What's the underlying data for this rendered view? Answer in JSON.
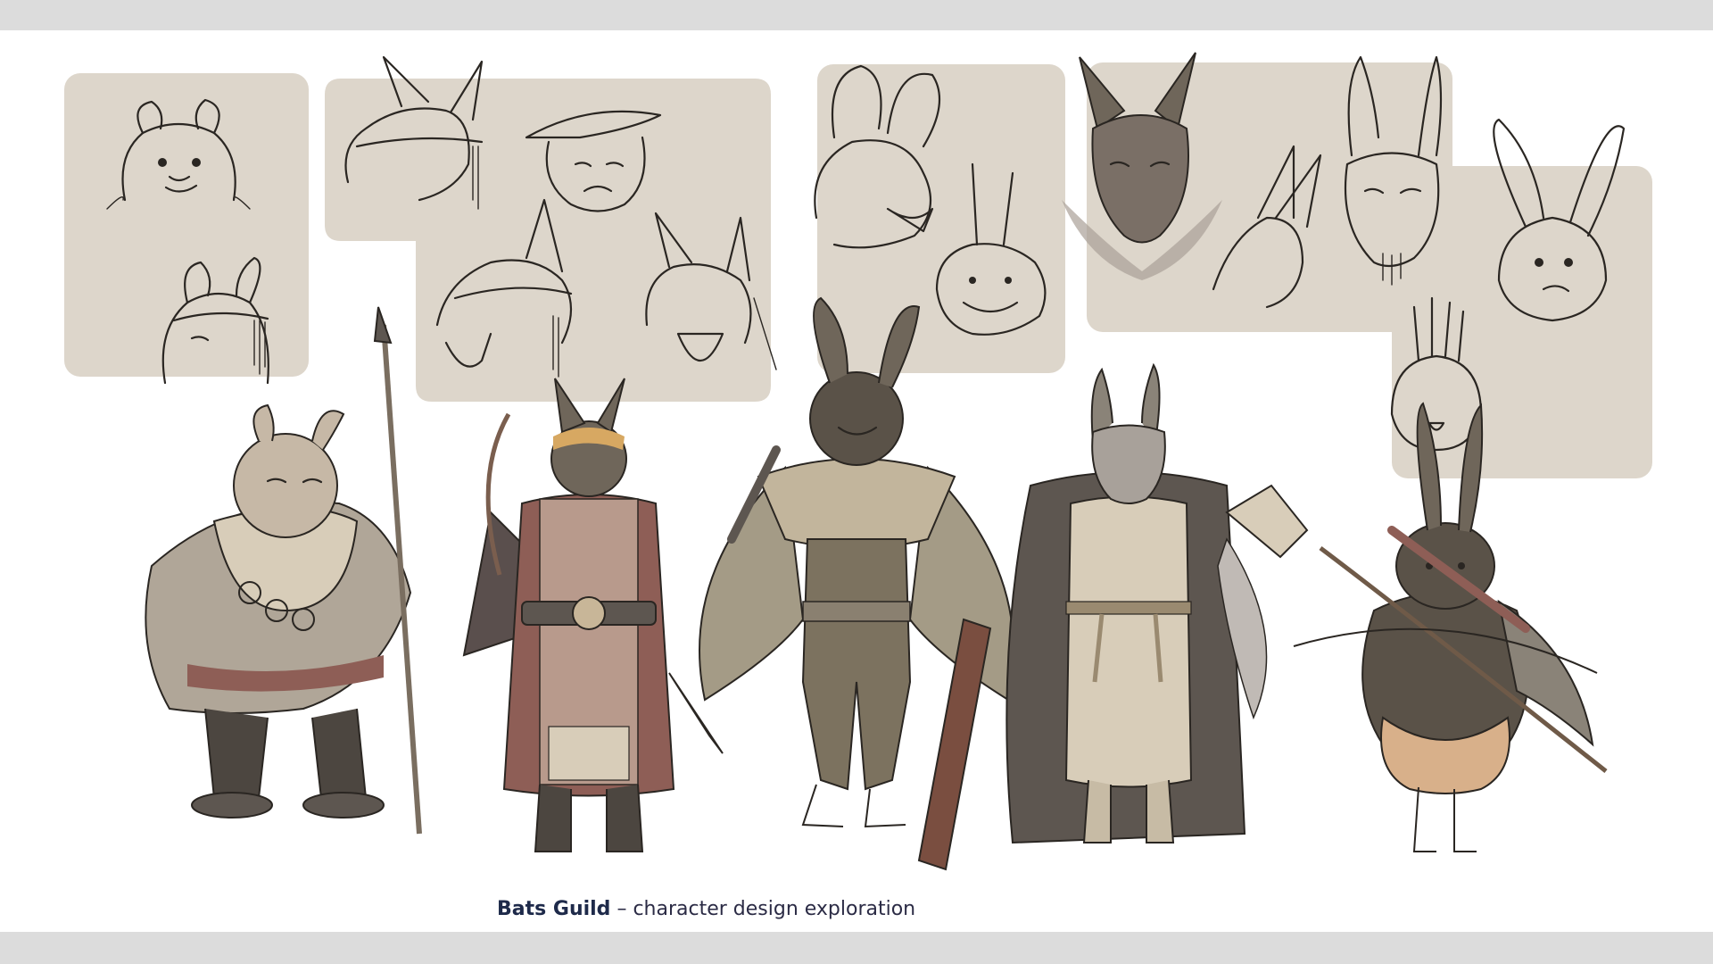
{
  "caption": {
    "title": "Bats Guild",
    "separator": "–",
    "subtitle": "character design exploration"
  },
  "colors": {
    "page_bg": "#dcdcdc",
    "sheet_bg": "#ffffff",
    "panel_bg": "#ddd6cb",
    "ink": "#2a2622",
    "caption_title": "#1e2a4a",
    "fur_brown": "#6f665a",
    "fur_grey": "#8a8378",
    "cloth_red": "#8e5e56",
    "cloth_beige": "#d8cdb9",
    "cloth_dark": "#5d5650",
    "pants_orange": "#d8b08a"
  },
  "panels": [
    {
      "name": "sketch-panel-1"
    },
    {
      "name": "sketch-panel-2"
    },
    {
      "name": "sketch-panel-3"
    },
    {
      "name": "sketch-panel-4"
    },
    {
      "name": "sketch-panel-5"
    }
  ],
  "characters": [
    {
      "name": "bat-spear-bearer"
    },
    {
      "name": "bat-dagger-wielder"
    },
    {
      "name": "bat-board-carrier"
    },
    {
      "name": "bat-elder-with-book"
    },
    {
      "name": "bat-archer"
    }
  ]
}
